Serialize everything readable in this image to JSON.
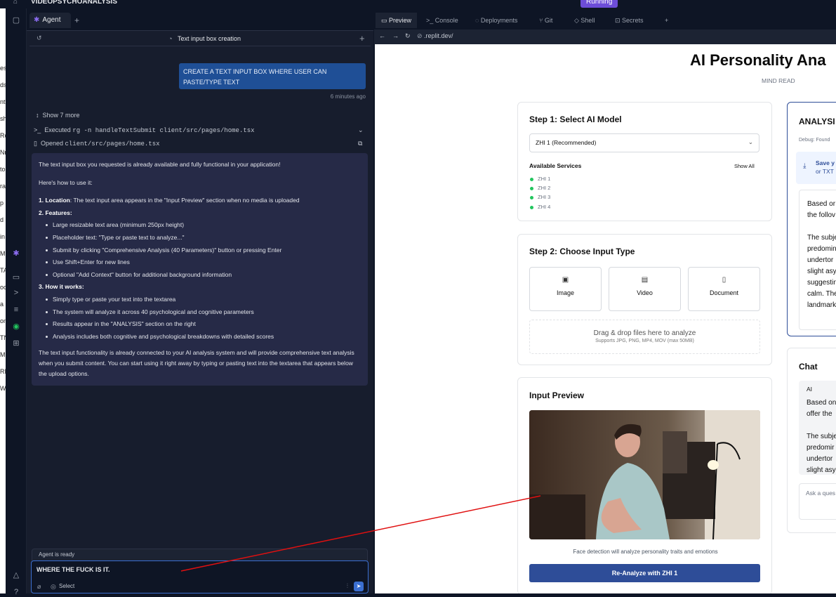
{
  "topbar": {
    "project": "VIDEOPSYCHOANALYSIS",
    "status": "Running"
  },
  "left_strip_chars": [
    "es",
    "ds",
    "nt",
    "sh",
    "Ro",
    "Nr",
    "to",
    "rai",
    "p",
    "d",
    "in",
    "M",
    "TA",
    "oc",
    "a",
    "on",
    "TN",
    "M",
    "RI",
    "W"
  ],
  "agent": {
    "tab_label": "Agent",
    "thread_title": "Text input box creation",
    "user_message": "CREATE A TEXT INPUT BOX WHERE USER CAN PASTE/TYPE TEXT",
    "time_ago": "6 minutes ago",
    "show_more": "Show 7 more",
    "executed_label": "Executed",
    "executed_cmd": "rg -n handleTextSubmit client/src/pages/home.tsx",
    "opened_label": "Opened",
    "opened_file": "client/src/pages/home.tsx",
    "response": {
      "intro": "The text input box you requested is already available and fully functional in your application!",
      "howto": "Here's how to use it:",
      "location_label": "1. Location",
      "location_text": ": The text input area appears in the \"Input Preview\" section when no media is uploaded",
      "features_label": "2. Features",
      "features": [
        "Large resizable text area (minimum 250px height)",
        "Placeholder text: \"Type or paste text to analyze...\"",
        "Submit by clicking \"Comprehensive Analysis (40 Parameters)\" button or pressing Enter",
        "Use Shift+Enter for new lines",
        "Optional \"Add Context\" button for additional background information"
      ],
      "how_label": "3. How it works",
      "how": [
        "Simply type or paste your text into the textarea",
        "The system will analyze it across 40 psychological and cognitive parameters",
        "Results appear in the \"ANALYSIS\" section on the right",
        "Analysis includes both cognitive and psychological breakdowns with detailed scores"
      ],
      "outro": "The text input functionality is already connected to your AI analysis system and will provide comprehensive text analysis when you submit content. You can start using it right away by typing or pasting text into the textarea that appears below the upload options."
    },
    "ready_text": "Agent is ready",
    "input_value": "WHERE THE FUCK IS IT.",
    "select_label": "Select"
  },
  "ide_tabs": [
    "Preview",
    "Console",
    "Deployments",
    "Git",
    "Shell",
    "Secrets"
  ],
  "url": ".replit.dev/",
  "app": {
    "title": "AI Personality Ana",
    "subtitle": "MIND READ",
    "step1": {
      "title": "Step 1: Select AI Model",
      "selected_model": "ZHI 1 (Recommended)",
      "services_label": "Available Services",
      "show_all": "Show All",
      "services": [
        "ZHI 1",
        "ZHI 2",
        "ZHI 3",
        "ZHI 4"
      ]
    },
    "step2": {
      "title": "Step 2: Choose Input Type",
      "types": [
        "Image",
        "Video",
        "Document"
      ],
      "drop_title": "Drag & drop files here to analyze",
      "drop_sub": "Supports JPG, PNG, MP4, MOV (max 50MB)"
    },
    "preview": {
      "title": "Input Preview",
      "caption": "Face detection will analyze personality traits and emotions",
      "button": "Re-Analyze with ZHI 1"
    },
    "analysis": {
      "title": "ANALYSI",
      "debug": "Debug: Found",
      "save_1": "Save y",
      "save_2": "or TXT",
      "lines": [
        "Based or",
        "the follov",
        "",
        "The subje",
        "predomin",
        "undertor",
        "slight asy",
        "suggestin",
        "calm. The",
        "landmark"
      ]
    },
    "chat": {
      "title": "Chat",
      "role": "AI",
      "lines": [
        "Based on",
        "offer the",
        "",
        "The subje",
        "predomir",
        "undertor",
        "slight asy"
      ],
      "placeholder": "Ask a ques"
    }
  }
}
